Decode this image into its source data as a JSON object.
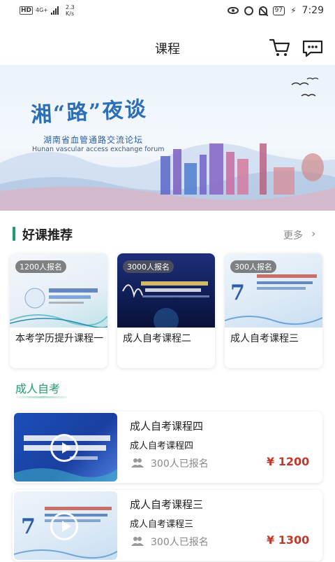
{
  "status_bar": {
    "hd": "HD",
    "net_type": "4G+",
    "speed_value": "2.3",
    "speed_unit": "K/s",
    "battery": "97",
    "time": "7:29"
  },
  "header": {
    "title": "课程",
    "cart_icon": "cart-icon",
    "message_icon": "message-icon"
  },
  "banner": {
    "title": "湘“路”夜谈",
    "subtitle": "湖南省血管通路交流论坛",
    "subtitle_en": "Hunan vascular access exchange forum"
  },
  "recommend": {
    "title": "好课推荐",
    "more": "更多",
    "cards": [
      {
        "badge": "1200人报名",
        "name": "本考学历提升课程一"
      },
      {
        "badge": "3000人报名",
        "name": "成人自考课程二"
      },
      {
        "badge": "300人报名",
        "name": "成人自考课程三"
      }
    ]
  },
  "category": {
    "title": "成人自考",
    "items": [
      {
        "title": "成人自考课程四",
        "subtitle": "成人自考课程四",
        "count": "300人已报名",
        "price": "¥ 1200"
      },
      {
        "title": "成人自考课程三",
        "subtitle": "成人自考课程三",
        "count": "300人已报名",
        "price": "¥ 1300"
      }
    ]
  },
  "colors": {
    "accent": "#1e9c6e",
    "price": "#c0392b"
  }
}
